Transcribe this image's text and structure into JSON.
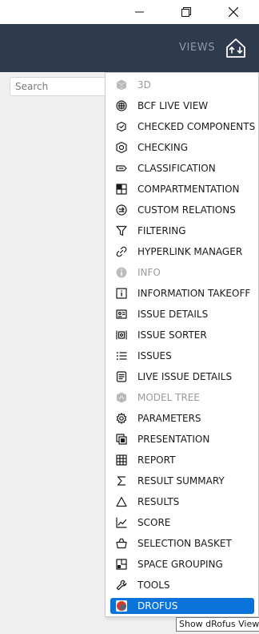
{
  "window": {
    "minimize_icon": "minimize-icon",
    "maximize_icon": "restore-icon",
    "close_icon": "close-icon"
  },
  "header": {
    "views_label": "VIEWS",
    "views_icon": "house-arrows-icon",
    "background": "#2f3a4d"
  },
  "search": {
    "placeholder": "Search",
    "value": ""
  },
  "menu": {
    "items": [
      {
        "label": "3D",
        "icon": "cube-icon",
        "disabled": true
      },
      {
        "label": "BCF LIVE VIEW",
        "icon": "bcf-live-icon"
      },
      {
        "label": "CHECKED COMPONENTS",
        "icon": "checked-components-icon"
      },
      {
        "label": "CHECKING",
        "icon": "checking-icon"
      },
      {
        "label": "CLASSIFICATION",
        "icon": "classification-icon"
      },
      {
        "label": "COMPARTMENTATION",
        "icon": "compartmentation-icon"
      },
      {
        "label": "CUSTOM RELATIONS",
        "icon": "custom-relations-icon"
      },
      {
        "label": "FILTERING",
        "icon": "filter-icon"
      },
      {
        "label": "HYPERLINK MANAGER",
        "icon": "link-icon"
      },
      {
        "label": "INFO",
        "icon": "info-circle-icon",
        "disabled": true
      },
      {
        "label": "INFORMATION TAKEOFF",
        "icon": "information-takeoff-icon"
      },
      {
        "label": "ISSUE DETAILS",
        "icon": "issue-details-icon"
      },
      {
        "label": "ISSUE SORTER",
        "icon": "issue-sorter-icon"
      },
      {
        "label": "ISSUES",
        "icon": "list-icon"
      },
      {
        "label": "LIVE ISSUE DETAILS",
        "icon": "live-issue-details-icon"
      },
      {
        "label": "MODEL TREE",
        "icon": "model-tree-icon",
        "disabled": true
      },
      {
        "label": "PARAMETERS",
        "icon": "gear-icon"
      },
      {
        "label": "PRESENTATION",
        "icon": "presentation-icon"
      },
      {
        "label": "REPORT",
        "icon": "table-icon"
      },
      {
        "label": "RESULT SUMMARY",
        "icon": "sigma-icon"
      },
      {
        "label": "RESULTS",
        "icon": "triangle-icon"
      },
      {
        "label": "SCORE",
        "icon": "trend-chart-icon"
      },
      {
        "label": "SELECTION BASKET",
        "icon": "basket-icon"
      },
      {
        "label": "SPACE GROUPING",
        "icon": "space-grouping-icon"
      },
      {
        "label": "TOOLS",
        "icon": "wrench-icon"
      },
      {
        "label": "DROFUS",
        "icon": "drofus-icon",
        "selected": true
      }
    ]
  },
  "tooltip": {
    "text": "Show dRofus View"
  },
  "colors": {
    "selected_background": "#0a73d9",
    "disabled_text": "#9a9a9a"
  }
}
